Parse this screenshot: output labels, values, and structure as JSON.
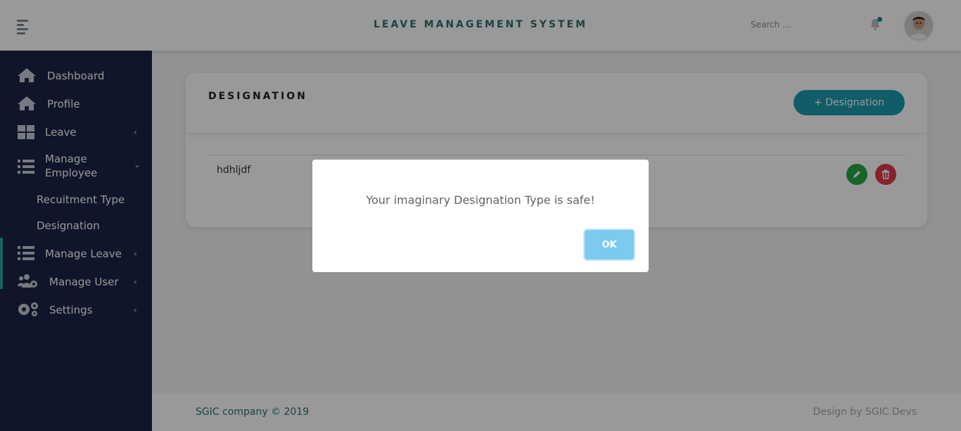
{
  "header": {
    "title": "LEAVE MANAGEMENT SYSTEM",
    "search_placeholder": "Search ..."
  },
  "sidebar": {
    "items": [
      {
        "label": "Dashboard",
        "icon": "home-icon"
      },
      {
        "label": "Profile",
        "icon": "home-icon"
      },
      {
        "label": "Leave",
        "icon": "grid-icon",
        "chevron": "‹"
      },
      {
        "label_line1": "Manage",
        "label_line2": "Employee",
        "icon": "list-icon",
        "chevron": "⌄"
      },
      {
        "label": "Manage Leave",
        "icon": "list-icon",
        "chevron": "‹"
      },
      {
        "label": "Manage User",
        "icon": "users-cog-icon",
        "chevron": "‹"
      },
      {
        "label": "Settings",
        "icon": "gears-icon",
        "chevron": "‹"
      }
    ],
    "sub_items": [
      {
        "label": "Recuitment Type"
      },
      {
        "label": "Designation"
      }
    ]
  },
  "main": {
    "card_title": "DESIGNATION",
    "add_button": "+ Designation",
    "rows": [
      {
        "name": "hdhljdf"
      }
    ]
  },
  "footer": {
    "left": "SGIC company © 2019",
    "right": "Design by SGIC Devs"
  },
  "modal": {
    "message": "Your imaginary Designation Type is safe!",
    "ok_label": "OK"
  },
  "colors": {
    "sidebar_bg": "#1c2345",
    "accent_teal": "#1c9aad",
    "edit_green": "#27a645",
    "delete_red": "#e13a4a",
    "ok_blue": "#7ccbef"
  }
}
